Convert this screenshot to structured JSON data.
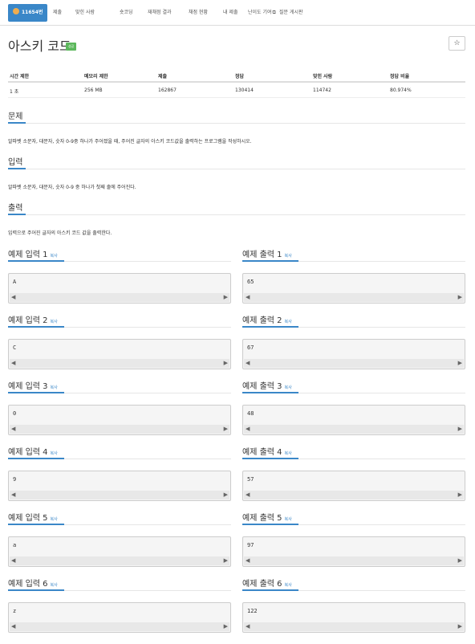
{
  "tabs": [
    {
      "label": "11654번",
      "active": true
    },
    {
      "label": "제출"
    },
    {
      "label": "맞힌 사람"
    },
    {
      "label": "숏코딩"
    },
    {
      "label": "재채점 결과"
    },
    {
      "label": "채점 현황"
    },
    {
      "label": "내 제출"
    },
    {
      "label": "난이도 기여"
    },
    {
      "label": "질문 게시판"
    }
  ],
  "problem": {
    "title": "아스키 코드",
    "badge": "성공",
    "star": "☆"
  },
  "info": {
    "headers": [
      "시간 제한",
      "메모리 제한",
      "제출",
      "정답",
      "맞힌 사람",
      "정답 비율"
    ],
    "values": [
      "1 초",
      "256 MB",
      "162867",
      "130414",
      "114742",
      "80.974%"
    ]
  },
  "sections": {
    "problem": {
      "title": "문제",
      "text": "알파벳 소문자, 대문자, 숫자 0-9중 하나가 주어졌을 때, 주어진 글자의 아스키 코드값을 출력하는 프로그램을 작성하시오."
    },
    "input": {
      "title": "입력",
      "text": "알파벳 소문자, 대문자, 숫자 0-9 중 하나가 첫째 줄에 주어진다."
    },
    "output": {
      "title": "출력",
      "text": "입력으로 주어진 글자의 아스키 코드 값을 출력한다."
    }
  },
  "copy_label": "복사",
  "samples": [
    {
      "in_title": "예제 입력 1",
      "out_title": "예제 출력 1",
      "input": "A",
      "output": "65"
    },
    {
      "in_title": "예제 입력 2",
      "out_title": "예제 출력 2",
      "input": "C",
      "output": "67"
    },
    {
      "in_title": "예제 입력 3",
      "out_title": "예제 출력 3",
      "input": "0",
      "output": "48"
    },
    {
      "in_title": "예제 입력 4",
      "out_title": "예제 출력 4",
      "input": "9",
      "output": "57"
    },
    {
      "in_title": "예제 입력 5",
      "out_title": "예제 출력 5",
      "input": "a",
      "output": "97"
    },
    {
      "in_title": "예제 입력 6",
      "out_title": "예제 출력 6",
      "input": "z",
      "output": "122"
    }
  ],
  "colors": {
    "accent": "#3a87c8",
    "success": "#5cb85c",
    "medal": "#f0ad4e"
  }
}
